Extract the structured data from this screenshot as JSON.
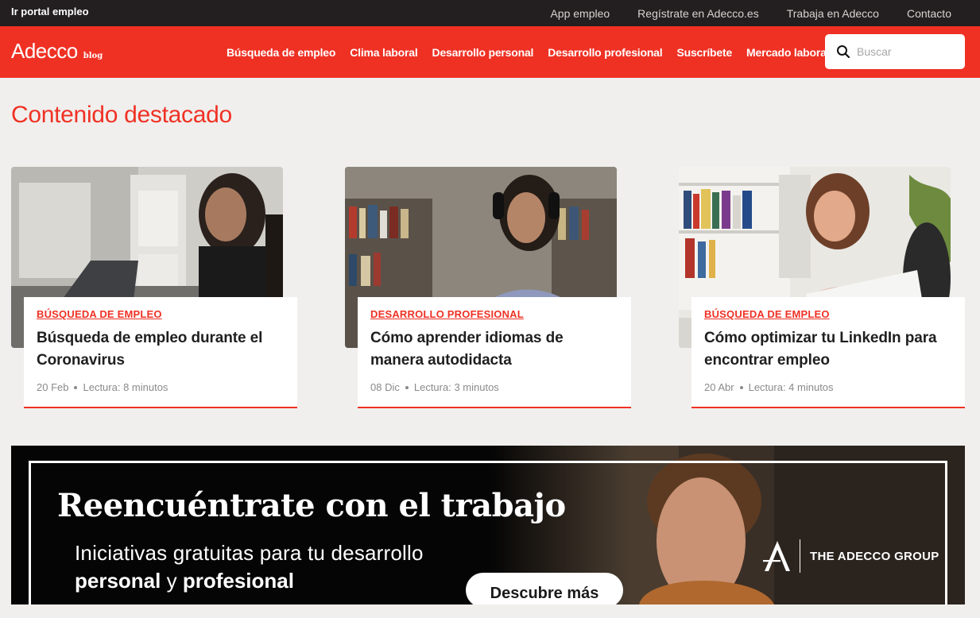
{
  "topbar": {
    "portal_link": "Ir portal empleo",
    "links": [
      "App empleo",
      "Regístrate en Adecco.es",
      "Trabaja en Adecco",
      "Contacto"
    ]
  },
  "header": {
    "logo_brand": "Adecco",
    "logo_sub": "blog",
    "menu": [
      "Búsqueda de empleo",
      "Clima laboral",
      "Desarrollo personal",
      "Desarrollo profesional",
      "Suscríbete",
      "Mercado laboral"
    ],
    "search_placeholder": "Buscar",
    "search_icon": "search-icon"
  },
  "colors": {
    "brand_red": "#ef3124",
    "topbar_bg": "#231f20",
    "page_bg": "#f0efed"
  },
  "main": {
    "section_title": "Contenido destacado",
    "cards": [
      {
        "category": "Búsqueda de empleo",
        "title": "Búsqueda de empleo durante el Coronavirus",
        "date": "20 Feb",
        "reading": "Lectura: 8 minutos"
      },
      {
        "category": "Desarrollo profesional",
        "title": "Cómo aprender idiomas de manera autodidacta",
        "date": "08 Dic",
        "reading": "Lectura: 3 minutos"
      },
      {
        "category": "Búsqueda de empleo",
        "title": "Cómo optimizar tu LinkedIn para encontrar empleo",
        "date": "20 Abr",
        "reading": "Lectura: 4 minutos"
      }
    ]
  },
  "banner": {
    "headline": "Reencuéntrate con el trabajo",
    "line1": "Iniciativas gratuitas para tu desarrollo",
    "line2_a": "personal",
    "line2_b": " y ",
    "line2_c": "profesional",
    "cta": "Descubre más",
    "group_name": "THE ADECCO GROUP"
  }
}
